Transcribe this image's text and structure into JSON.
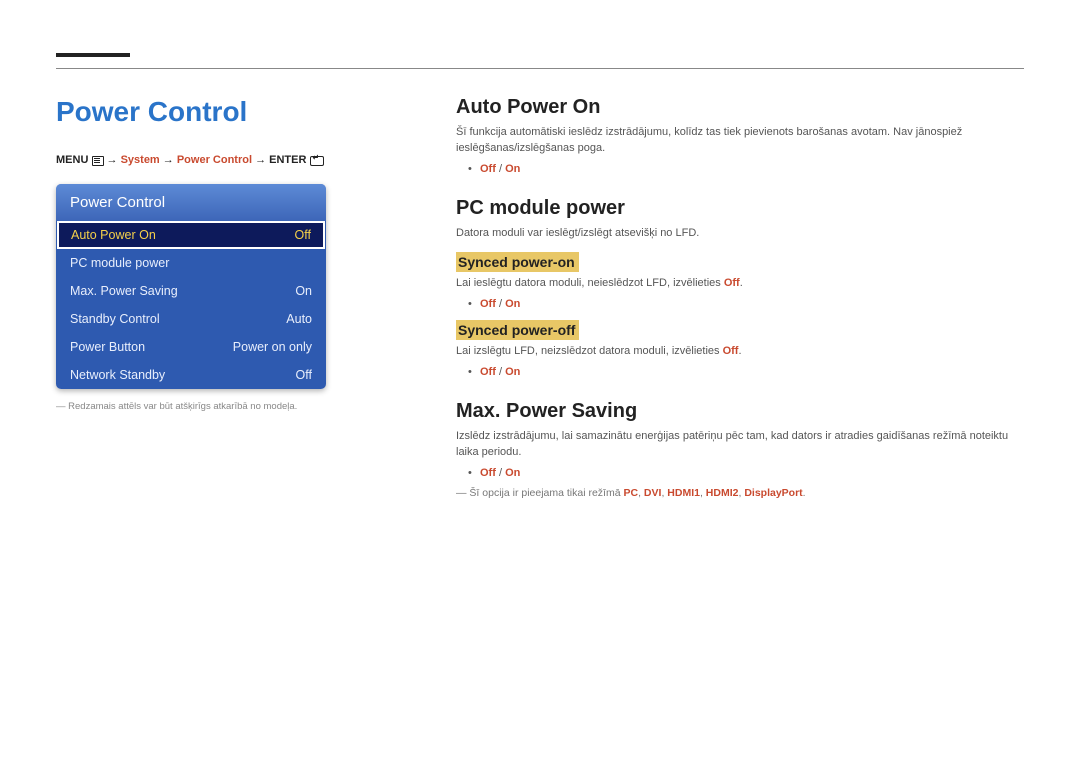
{
  "left": {
    "title": "Power Control",
    "breadcrumb": {
      "menu": "MENU",
      "arrow": "→",
      "system": "System",
      "power_control": "Power Control",
      "enter": "ENTER"
    },
    "panel": {
      "title": "Power Control",
      "rows": [
        {
          "label": "Auto Power On",
          "value": "Off",
          "selected": true
        },
        {
          "label": "PC module power",
          "value": "",
          "selected": false
        },
        {
          "label": "Max. Power Saving",
          "value": "On",
          "selected": false
        },
        {
          "label": "Standby Control",
          "value": "Auto",
          "selected": false
        },
        {
          "label": "Power Button",
          "value": "Power on only",
          "selected": false
        },
        {
          "label": "Network Standby",
          "value": "Off",
          "selected": false
        }
      ]
    },
    "footnote": "Redzamais attēls var būt atšķirīgs atkarībā no modeļa."
  },
  "right": {
    "auto_power_on": {
      "heading": "Auto Power On",
      "body": "Šī funkcija automātiski ieslēdz izstrādājumu, kolīdz tas tiek pievienots barošanas avotam. Nav jānospiež ieslēgšanas/izslēgšanas poga.",
      "opt_off": "Off",
      "opt_on": "On"
    },
    "pc_module": {
      "heading": "PC module power",
      "body": "Datora moduli var ieslēgt/izslēgt atsevišķi no LFD.",
      "synced_on": {
        "heading": "Synced power-on",
        "body_pre": "Lai ieslēgtu datora moduli, neieslēdzot LFD, izvēlieties ",
        "body_off": "Off",
        "body_post": ".",
        "opt_off": "Off",
        "opt_on": "On"
      },
      "synced_off": {
        "heading": "Synced power-off",
        "body_pre": "Lai izslēgtu LFD, neizslēdzot datora moduli, izvēlieties ",
        "body_off": "Off",
        "body_post": ".",
        "opt_off": "Off",
        "opt_on": "On"
      }
    },
    "max_power": {
      "heading": "Max. Power Saving",
      "body": "Izslēdz izstrādājumu, lai samazinātu enerģijas patēriņu pēc tam, kad dators ir atradies gaidīšanas režīmā noteiktu laika periodu.",
      "opt_off": "Off",
      "opt_on": "On",
      "note_pre": "Šī opcija ir pieejama tikai režīmā ",
      "modes": [
        "PC",
        "DVI",
        "HDMI1",
        "HDMI2",
        "DisplayPort"
      ],
      "note_post": "."
    }
  }
}
